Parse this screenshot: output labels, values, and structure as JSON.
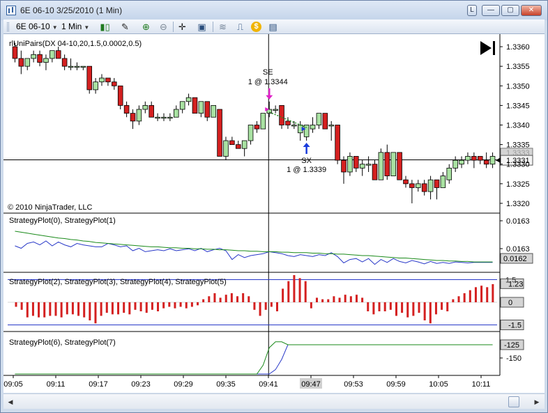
{
  "window": {
    "title": "6E 06-10  3/25/2010 (1 Min)",
    "btn_link": "L",
    "btn_min": "—",
    "btn_max": "▢",
    "btn_close": "✕"
  },
  "toolbar": {
    "instrument": "6E 06-10",
    "interval": "1 Min",
    "caret": "▼",
    "icons": {
      "candles": "▮▯",
      "pencil": "✎",
      "zoom_in": "⊕",
      "zoom_out": "⊖",
      "crosshair": "✛",
      "properties": "▣",
      "strategy": "≋",
      "indicator": "⎍",
      "dollar": "$",
      "data_box": "▤"
    }
  },
  "scroll": {
    "left_arrow": "◀",
    "right_arrow": "▶"
  },
  "chart_data": {
    "type": "candlestick",
    "title": "",
    "xlabel": "",
    "ylabel": "",
    "times": [
      "09:05",
      "09:11",
      "09:17",
      "09:23",
      "09:29",
      "09:35",
      "09:41",
      "09:47",
      "09:53",
      "09:59",
      "10:05",
      "10:11"
    ],
    "highlighted_time": "09:47",
    "price_panel": {
      "indicator_label": "rlUniPairs(DX 04-10,20,1.5,0.0002,0.5)",
      "copyright": "© 2010 NinjaTrader, LLC",
      "ylim": [
        1.33175,
        1.33625
      ],
      "y_ticks": [
        "1.3360",
        "1.3355",
        "1.3350",
        "1.3345",
        "1.3340",
        "1.3335",
        "1.3330",
        "1.3325",
        "1.3320"
      ],
      "current_price": "1.3331",
      "hidden_price_label": "1.3333",
      "crosshair_price": 1.33311,
      "bull_color": "#a9e2a2",
      "bear_color": "#d42020",
      "ohlc": [
        [
          1.336,
          1.3361,
          1.3356,
          1.3357
        ],
        [
          1.3357,
          1.3359,
          1.3353,
          1.3355
        ],
        [
          1.3355,
          1.3357,
          1.3354,
          1.3357
        ],
        [
          1.3357,
          1.3359,
          1.3356,
          1.3358
        ],
        [
          1.3358,
          1.3359,
          1.3355,
          1.3356
        ],
        [
          1.3356,
          1.3358,
          1.3354,
          1.3357
        ],
        [
          1.3357,
          1.3359,
          1.3356,
          1.3359
        ],
        [
          1.3359,
          1.336,
          1.3357,
          1.3357
        ],
        [
          1.3357,
          1.3358,
          1.3354,
          1.3355
        ],
        [
          1.3355,
          1.3357,
          1.3354,
          1.3355
        ],
        [
          1.3355,
          1.3356,
          1.3354,
          1.3355
        ],
        [
          1.3355,
          1.3355,
          1.3354,
          1.3355
        ],
        [
          1.3355,
          1.3355,
          1.3348,
          1.3349
        ],
        [
          1.3349,
          1.3352,
          1.3348,
          1.3351
        ],
        [
          1.3351,
          1.3353,
          1.335,
          1.3352
        ],
        [
          1.3352,
          1.3352,
          1.335,
          1.3351
        ],
        [
          1.3351,
          1.3352,
          1.3349,
          1.335
        ],
        [
          1.335,
          1.335,
          1.3344,
          1.3345
        ],
        [
          1.3345,
          1.3346,
          1.3342,
          1.3343
        ],
        [
          1.3343,
          1.3344,
          1.3339,
          1.3341
        ],
        [
          1.3341,
          1.3345,
          1.334,
          1.3344
        ],
        [
          1.3344,
          1.3346,
          1.3343,
          1.3345
        ],
        [
          1.3345,
          1.3346,
          1.3342,
          1.3342
        ],
        [
          1.3342,
          1.3343,
          1.3341,
          1.3342
        ],
        [
          1.3342,
          1.3343,
          1.3341,
          1.3342
        ],
        [
          1.3342,
          1.3343,
          1.3341,
          1.3342
        ],
        [
          1.3342,
          1.3345,
          1.3342,
          1.3344
        ],
        [
          1.3344,
          1.3346,
          1.3343,
          1.3346
        ],
        [
          1.3346,
          1.3348,
          1.3345,
          1.3347
        ],
        [
          1.3347,
          1.3347,
          1.3343,
          1.3343
        ],
        [
          1.3343,
          1.3346,
          1.3342,
          1.3346
        ],
        [
          1.3346,
          1.3346,
          1.3341,
          1.3342
        ],
        [
          1.3342,
          1.3345,
          1.3342,
          1.3345
        ],
        [
          1.3344,
          1.3344,
          1.3332,
          1.3332
        ],
        [
          1.3332,
          1.3337,
          1.3331,
          1.3336
        ],
        [
          1.3336,
          1.3337,
          1.3335,
          1.3335
        ],
        [
          1.3335,
          1.3336,
          1.3334,
          1.3334
        ],
        [
          1.3334,
          1.3336,
          1.3332,
          1.3336
        ],
        [
          1.3336,
          1.334,
          1.3335,
          1.334
        ],
        [
          1.334,
          1.3341,
          1.3338,
          1.3339
        ],
        [
          1.3339,
          1.3343,
          1.3339,
          1.3343
        ],
        [
          1.3343,
          1.3346,
          1.3342,
          1.3344
        ],
        [
          1.3344,
          1.3345,
          1.3343,
          1.3344
        ],
        [
          1.3345,
          1.3345,
          1.3339,
          1.334
        ],
        [
          1.3341,
          1.3342,
          1.3339,
          1.334
        ],
        [
          1.334,
          1.3341,
          1.3339,
          1.334
        ],
        [
          1.3338,
          1.3341,
          1.3336,
          1.334
        ],
        [
          1.3337,
          1.334,
          1.3336,
          1.334
        ],
        [
          1.3339,
          1.3342,
          1.3338,
          1.334
        ],
        [
          1.334,
          1.3343,
          1.3339,
          1.3343
        ],
        [
          1.3343,
          1.3343,
          1.3339,
          1.3339
        ],
        [
          1.334,
          1.3341,
          1.3336,
          1.334
        ],
        [
          1.334,
          1.334,
          1.333,
          1.3331
        ],
        [
          1.3331,
          1.3332,
          1.3325,
          1.3328
        ],
        [
          1.3328,
          1.3333,
          1.3327,
          1.3332
        ],
        [
          1.3332,
          1.3332,
          1.3328,
          1.3329
        ],
        [
          1.3329,
          1.3331,
          1.3327,
          1.333
        ],
        [
          1.333,
          1.3332,
          1.3328,
          1.333
        ],
        [
          1.333,
          1.3331,
          1.3326,
          1.3326
        ],
        [
          1.3326,
          1.3334,
          1.3326,
          1.3333
        ],
        [
          1.3333,
          1.3335,
          1.3326,
          1.3327
        ],
        [
          1.3327,
          1.3333,
          1.3327,
          1.3333
        ],
        [
          1.3333,
          1.3333,
          1.3326,
          1.3326
        ],
        [
          1.3326,
          1.3327,
          1.3324,
          1.3325
        ],
        [
          1.3325,
          1.3326,
          1.332,
          1.3324
        ],
        [
          1.3324,
          1.3326,
          1.3323,
          1.3325
        ],
        [
          1.3325,
          1.3326,
          1.3322,
          1.3323
        ],
        [
          1.3323,
          1.3327,
          1.3321,
          1.3326
        ],
        [
          1.3326,
          1.3326,
          1.3321,
          1.3324
        ],
        [
          1.3324,
          1.3328,
          1.3324,
          1.3327
        ],
        [
          1.3326,
          1.333,
          1.3325,
          1.3329
        ],
        [
          1.3329,
          1.3332,
          1.3328,
          1.3331
        ],
        [
          1.333,
          1.3332,
          1.3329,
          1.3331
        ],
        [
          1.3331,
          1.3333,
          1.333,
          1.3332
        ],
        [
          1.3332,
          1.3333,
          1.3329,
          1.3331
        ],
        [
          1.3332,
          1.3332,
          1.333,
          1.3331
        ],
        [
          1.3331,
          1.3333,
          1.3329,
          1.333
        ],
        [
          1.333,
          1.3333,
          1.3329,
          1.3332
        ]
      ],
      "signals": [
        {
          "name": "SE",
          "detail": "1 @ 1.3344",
          "index": 41,
          "price": 1.3344,
          "direction": "down",
          "color": "#e020c8"
        },
        {
          "name": "SX",
          "detail": "1 @ 1.3339",
          "index": 47,
          "price": 1.3339,
          "direction": "up",
          "color": "#1a3cdc"
        }
      ],
      "trade_line": {
        "from": [
          41,
          1.3344
        ],
        "to": [
          47,
          1.3339
        ],
        "color": "#1e8a1e"
      }
    },
    "panel2": {
      "label": "StrategyPlot(0), StrategyPlot(1)",
      "y_ticks": [
        "0.0163",
        "0.0163"
      ],
      "current": "0.0162",
      "series": [
        {
          "name": "StrategyPlot(0)",
          "color": "#2838c8",
          "values": [
            0.6,
            0.65,
            0.55,
            0.52,
            0.58,
            0.5,
            0.6,
            0.52,
            0.58,
            0.62,
            0.55,
            0.58,
            0.6,
            0.62,
            0.62,
            0.55,
            0.58,
            0.62,
            0.6,
            0.7,
            0.65,
            0.72,
            0.7,
            0.68,
            0.7,
            0.66,
            0.7,
            0.68,
            0.66,
            0.7,
            0.65,
            0.72,
            0.68,
            0.65,
            0.7,
            0.88,
            0.78,
            0.84,
            0.8,
            0.78,
            0.76,
            0.72,
            0.74,
            0.76,
            0.8,
            0.82,
            0.78,
            0.8,
            0.82,
            0.78,
            0.8,
            0.74,
            0.82,
            0.95,
            0.88,
            0.86,
            0.93,
            0.86,
            0.98,
            0.88,
            0.94,
            0.86,
            0.92,
            0.95,
            0.9,
            0.93,
            0.97,
            0.92,
            0.96,
            0.94,
            0.96,
            0.93,
            0.94,
            0.95,
            0.94,
            0.94,
            0.94,
            0.94
          ]
        },
        {
          "name": "StrategyPlot(1)",
          "color": "#1a8a1a",
          "values": [
            0.3,
            0.32,
            0.34,
            0.36,
            0.38,
            0.4,
            0.42,
            0.44,
            0.45,
            0.47,
            0.48,
            0.5,
            0.51,
            0.53,
            0.54,
            0.55,
            0.56,
            0.57,
            0.58,
            0.59,
            0.6,
            0.61,
            0.62,
            0.62,
            0.63,
            0.64,
            0.64,
            0.65,
            0.65,
            0.66,
            0.66,
            0.67,
            0.67,
            0.68,
            0.68,
            0.69,
            0.7,
            0.7,
            0.71,
            0.71,
            0.72,
            0.72,
            0.72,
            0.73,
            0.73,
            0.74,
            0.74,
            0.74,
            0.75,
            0.75,
            0.76,
            0.76,
            0.77,
            0.77,
            0.78,
            0.79,
            0.8,
            0.8,
            0.81,
            0.82,
            0.83,
            0.84,
            0.85,
            0.85,
            0.86,
            0.87,
            0.88,
            0.89,
            0.9,
            0.9,
            0.91,
            0.91,
            0.92,
            0.92,
            0.93,
            0.93,
            0.93,
            0.93
          ]
        }
      ]
    },
    "panel3": {
      "label": "StrategyPlot(2), StrategyPlot(3), StrategyPlot(4), StrategyPlot(5)",
      "ylim": [
        -1.8,
        1.8
      ],
      "y_ticks": [
        "1.5",
        "0",
        "-1.5"
      ],
      "current_labels": [
        "1.23",
        "0",
        "-1.5"
      ],
      "band_upper": 1.23,
      "band_lower": -1.5,
      "bar_color": "#d42020",
      "band_color": "#2838c8",
      "values": [
        -0.3,
        -0.5,
        -1.0,
        -0.9,
        -1.0,
        -1.0,
        -0.9,
        -0.9,
        -1.0,
        -0.8,
        -0.8,
        -0.9,
        -1.0,
        -1.2,
        -1.4,
        -0.9,
        -0.7,
        -0.8,
        -0.8,
        -0.7,
        -0.8,
        -0.5,
        -0.6,
        -0.7,
        -0.5,
        -0.6,
        -0.4,
        -0.3,
        -0.4,
        -0.3,
        -0.4,
        -0.3,
        -0.2,
        0.2,
        0.4,
        0.6,
        0.3,
        0.5,
        0.6,
        0.4,
        0.6,
        0.4,
        -0.5,
        -0.9,
        -0.5,
        -0.3,
        -0.6,
        0.9,
        1.4,
        1.8,
        1.6,
        1.4,
        -0.4,
        0.3,
        0.2,
        0.2,
        0.4,
        0.3,
        0.5,
        0.4,
        0.5,
        0.3,
        -0.6,
        -0.8,
        -0.6,
        -0.6,
        -0.5,
        -0.9,
        -0.7,
        -1.0,
        -0.9,
        -0.7,
        -1.2,
        -1.4,
        -0.8,
        -0.5,
        -0.6,
        0.2,
        0.4,
        0.6,
        0.8,
        1.0,
        1.1,
        1.0,
        1.2
      ]
    },
    "panel4": {
      "label": "StrategyPlot(6), StrategyPlot(7)",
      "y_ticks": [
        "-150"
      ],
      "current": "-125",
      "series": [
        {
          "name": "StrategyPlot(6)",
          "color": "#2838c8",
          "values": [
            0,
            0,
            0,
            0,
            0,
            0,
            0,
            0,
            0,
            0,
            0,
            0,
            0,
            0,
            0,
            0,
            0,
            0,
            0,
            0,
            0,
            0,
            0,
            0,
            0,
            0,
            0,
            0,
            0,
            0,
            0,
            0,
            0,
            0,
            0,
            0,
            0,
            0,
            0,
            0,
            0,
            0,
            0.15,
            0.5,
            1,
            1,
            1,
            1,
            1,
            1,
            1,
            1,
            1,
            1,
            1,
            1,
            1,
            1,
            1,
            1,
            1,
            1,
            1,
            1,
            1,
            1,
            1,
            1,
            1,
            1,
            1,
            1,
            1,
            1,
            1,
            1,
            1,
            1
          ]
        },
        {
          "name": "StrategyPlot(7)",
          "color": "#1a8a1a",
          "values": [
            0,
            0,
            0,
            0,
            0,
            0,
            0,
            0,
            0,
            0,
            0,
            0,
            0,
            0,
            0,
            0,
            0,
            0,
            0,
            0,
            0,
            0,
            0,
            0,
            0,
            0,
            0,
            0,
            0,
            0,
            0,
            0,
            0,
            0,
            0,
            0,
            0,
            0,
            0,
            0,
            0.3,
            0.9,
            1.1,
            1.1,
            1,
            1,
            1,
            1,
            1,
            1,
            1,
            1,
            1,
            1,
            1,
            1,
            1,
            1,
            1,
            1,
            1,
            1,
            1,
            1,
            1,
            1,
            1,
            1,
            1,
            1,
            1,
            1,
            1,
            1,
            1,
            1,
            1,
            1
          ]
        }
      ]
    }
  }
}
